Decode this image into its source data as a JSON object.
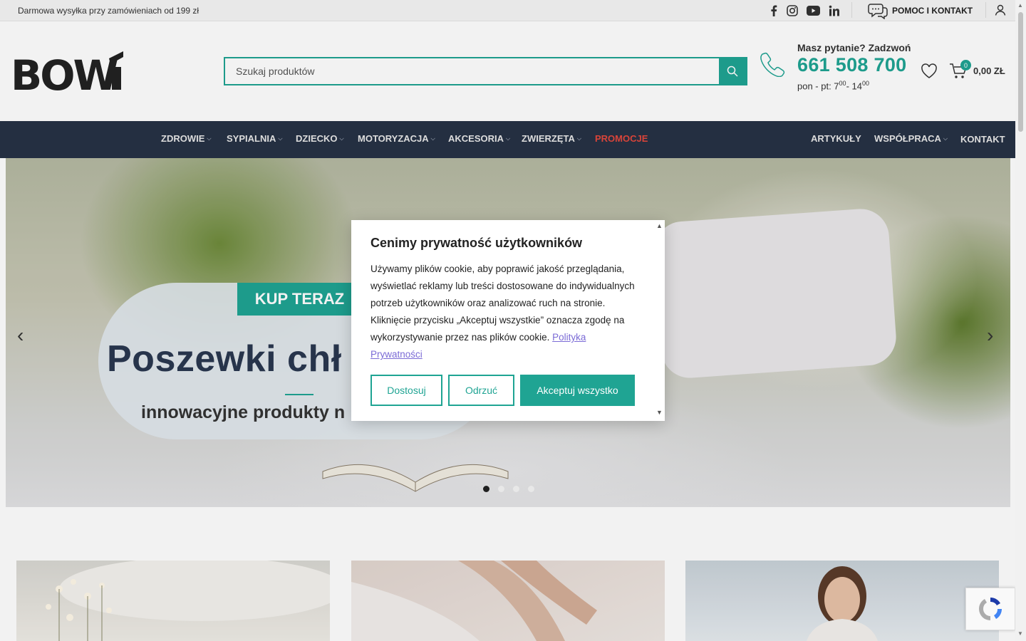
{
  "topbar": {
    "promo": "Darmowa wysyłka przy zamówieniach od 199 zł",
    "help": "POMOC I KONTAKT"
  },
  "search": {
    "placeholder": "Szukaj produktów"
  },
  "phone": {
    "question": "Masz pytanie? Zadzwoń",
    "number": "661 508 700",
    "hours_prefix": "pon - pt: 7",
    "hours_sup1": "00",
    "hours_mid": "- 14",
    "hours_sup2": "00"
  },
  "cart": {
    "count": "0",
    "total": "0,00 ZŁ"
  },
  "nav": {
    "zdrowie": "ZDROWIE",
    "sypialnia": "SYPIALNIA",
    "dziecko": "DZIECKO",
    "motoryzacja": "MOTORYZACJA",
    "akcesoria": "AKCESORIA",
    "zwierzeta": "ZWIERZĘTA",
    "promocje": "PROMOCJE",
    "artykuly": "ARTYKUŁY",
    "wspolpraca": "WSPÓŁPRACA",
    "kontakt": "KONTAKT"
  },
  "hero": {
    "cta": "KUP TERAZ",
    "title": "Poszewki chł",
    "subtitle": "innowacyjne produkty n"
  },
  "cookie": {
    "title": "Cenimy prywatność użytkowników",
    "text": "Używamy plików cookie, aby poprawić jakość przeglądania, wyświetlać reklamy lub treści dostosowane do indywidualnych potrzeb użytkowników oraz analizować ruch na stronie. Kliknięcie przycisku „Akceptuj wszystkie” oznacza zgodę na wykorzystywanie przez nas plików cookie.",
    "link": "Polityka Prywatności",
    "customize": "Dostosuj",
    "reject": "Odrzuć",
    "accept": "Akceptuj wszystko"
  },
  "colors": {
    "accent": "#1fa493",
    "nav_bg": "#263245",
    "promo_red": "#e5483d"
  }
}
